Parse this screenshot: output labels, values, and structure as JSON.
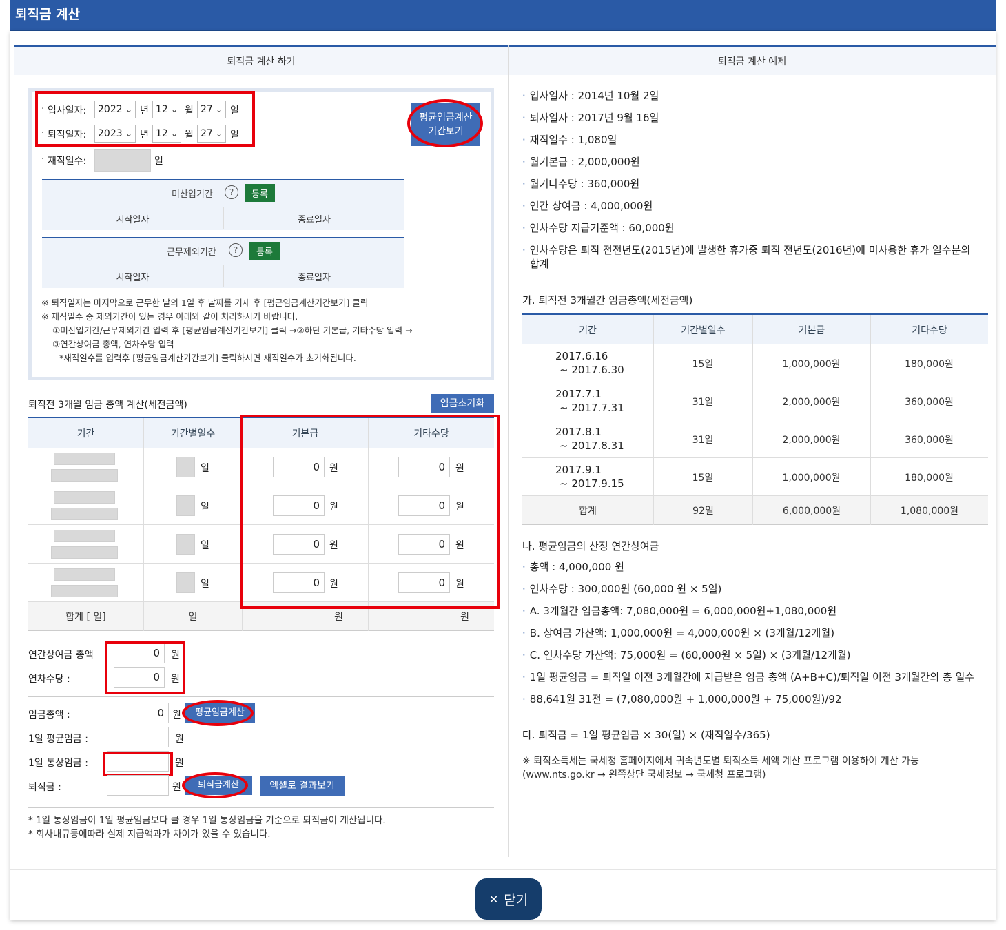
{
  "window": {
    "title": "퇴직금 계산"
  },
  "left": {
    "header": "퇴직금 계산 하기"
  },
  "right": {
    "header": "퇴직금 계산 예제"
  },
  "form": {
    "join_label": "입사일자:",
    "join_year": "2022",
    "join_month": "12",
    "join_day": "27",
    "leave_label": "퇴직일자:",
    "leave_year": "2023",
    "leave_month": "12",
    "leave_day": "27",
    "unit_year": "년",
    "unit_month": "월",
    "unit_day": "일",
    "work_days_label": "재직일수:",
    "work_days_unit": "일",
    "period_button": "평균임금계산\n기간보기",
    "unpaid_title": "미산입기간",
    "register": "등록",
    "start_col": "시작일자",
    "end_col": "종료일자",
    "excluded_title": "근무제외기간",
    "notes": [
      "※ 퇴직일자는 마지막으로 근무한 날의 1일 후 날짜를 기재 후 [평균임금계산기간보기] 클릭",
      "※ 재직일수 중 제외기간이 있는 경우 아래와 같이 처리하시기 바랍니다.",
      "①미산입기간/근무제외기간 입력 후 [평균임금계산기간보기] 클릭 →②하단 기본급, 기타수당 입력 →",
      "③연간상여금 총액, 연차수당 입력",
      "*재직일수를 입력후 [평균임금계산기간보기] 클릭하시면 재직일수가 초기화됩니다."
    ]
  },
  "wage": {
    "title": "퇴직전 3개월 임금 총액 계산(세전금액)",
    "reset_button": "임금초기화",
    "cols": [
      "기간",
      "기간별일수",
      "기본급",
      "기타수당"
    ],
    "day_unit": "일",
    "won": "원",
    "rows": [
      {
        "basic": "0",
        "other": "0"
      },
      {
        "basic": "0",
        "other": "0"
      },
      {
        "basic": "0",
        "other": "0"
      },
      {
        "basic": "0",
        "other": "0"
      }
    ],
    "total_label": "합계 [       일]",
    "total_days": "일",
    "total_basic": "원",
    "total_other": "원"
  },
  "bonus": {
    "label": "연간상여금 총액",
    "value": "0",
    "unit": "원"
  },
  "leave_pay": {
    "label": "연차수당 :",
    "value": "0",
    "unit": "원"
  },
  "result": {
    "total_label": "임금총액 :",
    "total_value": "0",
    "unit": "원",
    "avg_button": "평균임금계산",
    "daily_avg_label": "1일 평균임금 :",
    "daily_ord_label": "1일 통상임금 :",
    "severance_label": "퇴직금 :",
    "sev_button": "퇴직금계산",
    "excel_button": "엑셀로 결과보기"
  },
  "footnotes": [
    "* 1일 통상임금이 1일 평균임금보다 클 경우 1일 통상임금을 기준으로 퇴직금이 계산됩니다.",
    "* 회사내규등에따라 실제 지급액과가 차이가 있을 수 있습니다."
  ],
  "example": {
    "items": [
      "입사일자 : 2014년 10월 2일",
      "퇴사일자 : 2017년 9월 16일",
      "재직일수 : 1,080일",
      "월기본급 : 2,000,000원",
      "월기타수당 : 360,000원",
      "연간 상여금 : 4,000,000원",
      "연차수당 지급기준액 : 60,000원",
      "연차수당은 퇴직 전전년도(2015년)에 발생한 휴가중 퇴직 전년도(2016년)에 미사용한 휴가 일수분의",
      "합계"
    ],
    "section_a": "가. 퇴직전 3개월간 임금총액(세전금액)",
    "table_cols": [
      "기간",
      "기간별일수",
      "기본급",
      "기타수당"
    ],
    "table_rows": [
      {
        "p1": "2017.6.16",
        "p2": "~ 2017.6.30",
        "days": "15일",
        "basic": "1,000,000원",
        "other": "180,000원"
      },
      {
        "p1": "2017.7.1",
        "p2": "~ 2017.7.31",
        "days": "31일",
        "basic": "2,000,000원",
        "other": "360,000원"
      },
      {
        "p1": "2017.8.1",
        "p2": "~ 2017.8.31",
        "days": "31일",
        "basic": "2,000,000원",
        "other": "360,000원"
      },
      {
        "p1": "2017.9.1",
        "p2": "~ 2017.9.15",
        "days": "15일",
        "basic": "1,000,000원",
        "other": "180,000원"
      }
    ],
    "total_row": {
      "label": "합계",
      "days": "92일",
      "basic": "6,000,000원",
      "other": "1,080,000원"
    },
    "section_b": "나. 평균임금의 산정 연간상여금",
    "b_items": [
      "총액 : 4,000,000 원",
      "연차수당 : 300,000원 (60,000 원 × 5일)",
      "A. 3개월간 임금총액: 7,080,000원 = 6,000,000원+1,080,000원",
      "B. 상여금 가산액: 1,000,000원 = 4,000,000원 × (3개월/12개월)",
      "C. 연차수당 가산액: 75,000원 = (60,000원 × 5일) × (3개월/12개월)",
      "1일 평균임금 = 퇴직일 이전 3개월간에 지급받은 임금 총액 (A+B+C)/퇴직일 이전 3개월간의 총 일수",
      "88,641원 31전 = (7,080,000원 + 1,000,000원 + 75,000원)/92"
    ],
    "section_c": "다. 퇴직금 = 1일 평균임금 × 30(일) × (재직일수/365)",
    "tax_note1": "※ 퇴직소득세는 국세청 홈페이지에서 귀속년도별 퇴직소득 세액 계산 프로그램 이용하여 계산 가능",
    "tax_note2": "(www.nts.go.kr → 왼쪽상단 국세정보 → 국세청 프로그램)"
  },
  "close_button": "닫기"
}
